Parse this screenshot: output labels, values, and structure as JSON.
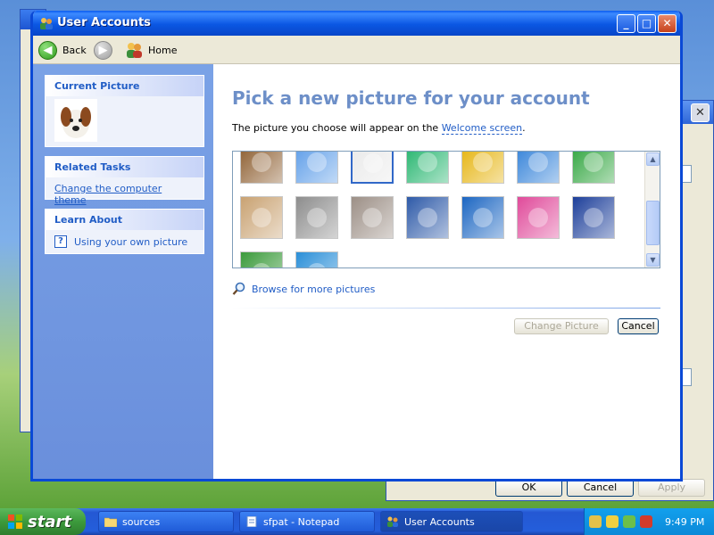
{
  "window": {
    "title": "User Accounts",
    "controls": {
      "minimize": "_",
      "maximize": "□",
      "close": "✕"
    }
  },
  "toolbar": {
    "back_label": "Back",
    "home_label": "Home"
  },
  "sidebar": {
    "current_picture": {
      "title": "Current Picture"
    },
    "related_tasks": {
      "title": "Related Tasks",
      "items": [
        {
          "label": "Change the computer theme"
        }
      ]
    },
    "learn_about": {
      "title": "Learn About",
      "items": [
        {
          "label": "Using your own picture"
        }
      ]
    }
  },
  "main": {
    "heading": "Pick a new picture for your account",
    "subtext_prefix": "The picture you choose will appear on the",
    "subtext_link": "Welcome screen",
    "subtext_suffix": ".",
    "browse_label": "Browse for more pictures",
    "change_picture_label": "Change Picture",
    "cancel_label": "Cancel",
    "pictures": [
      {
        "name": "chess-pieces",
        "color": "#8a5a2b"
      },
      {
        "name": "dirt-bike",
        "color": "#5a9be8"
      },
      {
        "name": "dog",
        "color": "#e9e9e9"
      },
      {
        "name": "fish",
        "color": "#1fb36a"
      },
      {
        "name": "duck",
        "color": "#e5b20a"
      },
      {
        "name": "flower-bud",
        "color": "#2f7fd8"
      },
      {
        "name": "frog",
        "color": "#2ca33a"
      },
      {
        "name": "guitar",
        "color": "#c9a272"
      },
      {
        "name": "horses",
        "color": "#8d8d8d"
      },
      {
        "name": "karate",
        "color": "#9c8f86"
      },
      {
        "name": "rocket-launch",
        "color": "#2e5aa8"
      },
      {
        "name": "palm-trees",
        "color": "#1c66c2"
      },
      {
        "name": "pink-flower",
        "color": "#e04a9a"
      },
      {
        "name": "orange-daisy",
        "color": "#1d3f9a"
      },
      {
        "name": "skateboarder",
        "color": "#3b9a3b"
      },
      {
        "name": "snowflake",
        "color": "#2b8fd8"
      }
    ]
  },
  "background_dialog": {
    "ok_label": "OK",
    "cancel_label": "Cancel",
    "apply_label": "Apply"
  },
  "taskbar": {
    "start_label": "start",
    "tasks": [
      {
        "label": "sources"
      },
      {
        "label": "sfpat - Notepad"
      },
      {
        "label": "User Accounts"
      }
    ],
    "clock": "9:49 PM"
  },
  "colors": {
    "title_blue": "#0a49d6",
    "link_blue": "#215dc6",
    "sidebar_blue": "#7aa2e6",
    "heading_blue": "#6d8fc8",
    "start_green": "#3c9a3c"
  }
}
